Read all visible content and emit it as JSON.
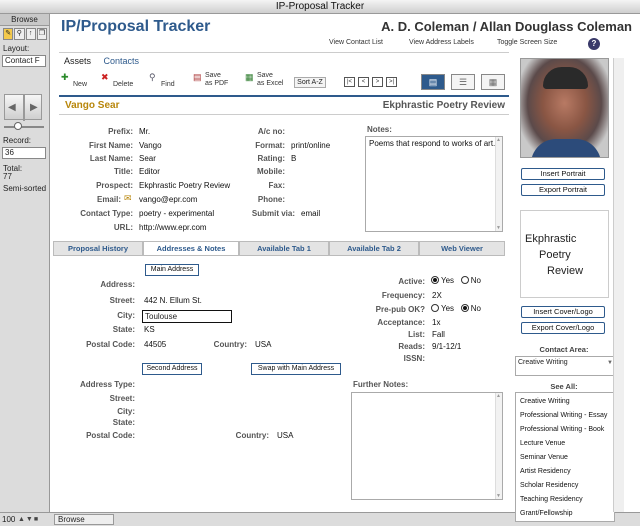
{
  "window": {
    "title": "IP-Proposal Tracker"
  },
  "status_pane": {
    "mode": "Browse",
    "layout_label": "Layout:",
    "layout_value": "Contact F",
    "record_label": "Record:",
    "record_value": "36",
    "total_label": "Total:",
    "total_value": "77",
    "sort_status": "Semi-sorted"
  },
  "bottom_bar": {
    "zoom": "100",
    "mode": "Browse"
  },
  "header": {
    "app_title": "IP/Proposal Tracker",
    "owner": "A. D. Coleman / Allan Douglass Coleman",
    "links": [
      "View Contact List",
      "View Address Labels",
      "Toggle Screen Size"
    ],
    "help": "?"
  },
  "nav_tabs": [
    "Assets",
    "Contacts"
  ],
  "toolbar": {
    "new": "New",
    "delete": "Delete",
    "find": "Find",
    "save_pdf_1": "Save",
    "save_pdf_2": "as PDF",
    "save_excel_1": "Save",
    "save_excel_2": "as Excel",
    "sort": "Sort A-Z",
    "nav": [
      "|<",
      "<",
      ">",
      ">|"
    ]
  },
  "record": {
    "name": "Vango Sear",
    "company": "Ekphrastic Poetry Review",
    "fields_left": [
      {
        "label": "Prefix:",
        "value": "Mr."
      },
      {
        "label": "First Name:",
        "value": "Vango"
      },
      {
        "label": "Last Name:",
        "value": "Sear"
      },
      {
        "label": "Title:",
        "value": "Editor"
      },
      {
        "label": "Prospect:",
        "value": "Ekphrastic Poetry Review"
      },
      {
        "label": "Email:",
        "value": "vango@epr.com"
      },
      {
        "label": "Contact Type:",
        "value": "poetry - experimental"
      },
      {
        "label": "URL:",
        "value": "http://www.epr.com"
      }
    ],
    "fields_mid": [
      {
        "label": "A/c no:",
        "value": ""
      },
      {
        "label": "Format:",
        "value": "print/online"
      },
      {
        "label": "Rating:",
        "value": "B"
      },
      {
        "label": "Mobile:",
        "value": ""
      },
      {
        "label": "Fax:",
        "value": ""
      },
      {
        "label": "Phone:",
        "value": ""
      },
      {
        "label": "Submit via:",
        "value": "email"
      }
    ],
    "notes_label": "Notes:",
    "notes": "Poems that respond to works of art."
  },
  "tabs": [
    "Proposal History",
    "Addresses & Notes",
    "Available Tab 1",
    "Available Tab 2",
    "Web Viewer"
  ],
  "address": {
    "main_address_btn": "Main Address",
    "address_label": "Address:",
    "street_label": "Street:",
    "street": "442 N. Ellum St.",
    "city_label": "City:",
    "city": "Toulouse",
    "state_label": "State:",
    "state": "KS",
    "postal_label": "Postal Code:",
    "postal": "44505",
    "country_label": "Country:",
    "country": "USA",
    "second_address_btn": "Second Address",
    "swap_btn": "Swap with Main Address",
    "type_label": "Address Type:",
    "street2_label": "Street:",
    "city2_label": "City:",
    "state2_label": "State:",
    "postal2_label": "Postal Code:",
    "country2_label": "Country:",
    "country2": "USA"
  },
  "status": {
    "active_label": "Active:",
    "yes": "Yes",
    "no": "No",
    "frequency_label": "Frequency:",
    "frequency": "2X",
    "prepub_label": "Pre-pub OK?",
    "yes2": "Yes",
    "no2": "No",
    "acceptance_label": "Acceptance:",
    "acceptance": "1x",
    "list_label": "List:",
    "list": "Fall",
    "reads_label": "Reads:",
    "reads": "9/1-12/1",
    "issn_label": "ISSN:",
    "issn": "",
    "further_notes_label": "Further Notes:"
  },
  "right": {
    "insert_portrait": "Insert Portrait",
    "export_portrait": "Export Portrait",
    "cover_lines": [
      "Ekphrastic",
      "Poetry",
      "Review"
    ],
    "insert_cover": "Insert Cover/Logo",
    "export_cover": "Export Cover/Logo",
    "contact_area_label": "Contact Area:",
    "contact_area": "Creative Writing",
    "see_all_label": "See All:",
    "see_all": [
      "Creative Writing",
      "Professional Writing - Essay",
      "Professional Writing - Book",
      "Lecture Venue",
      "Seminar Venue",
      "Artist Residency",
      "Scholar Residency",
      "Teaching Residency",
      "Grant/Fellowship"
    ]
  }
}
